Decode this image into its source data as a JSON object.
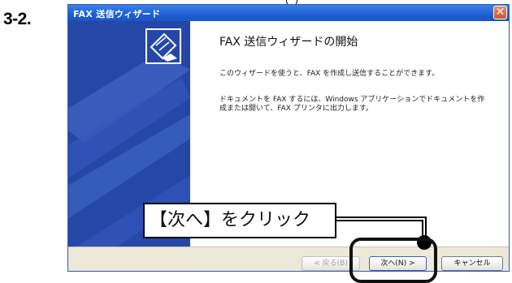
{
  "step": "3-2.",
  "window": {
    "title": "FAX 送信ウィザード",
    "close_glyph": "✕"
  },
  "wizard": {
    "heading": "FAX 送信ウィザードの開始",
    "description": "このウィザードを使うと、FAX を作成し送信することができます。",
    "description2": "ドキュメントを FAX するには、Windows アプリケーションでドキュメントを作成または開いて、FAX プリンタに出力します。"
  },
  "buttons": {
    "back": "< 戻る(B)",
    "next": "次へ(N) >",
    "cancel": "キャンセル"
  },
  "callout": {
    "text": "【次へ】をクリック"
  },
  "icons": {
    "close": "close-icon",
    "wizard": "fax-machine-icon"
  },
  "colors": {
    "titlebar": "#1e5fd2",
    "side_panel": "#2447a8",
    "close_button": "#d0542c"
  }
}
